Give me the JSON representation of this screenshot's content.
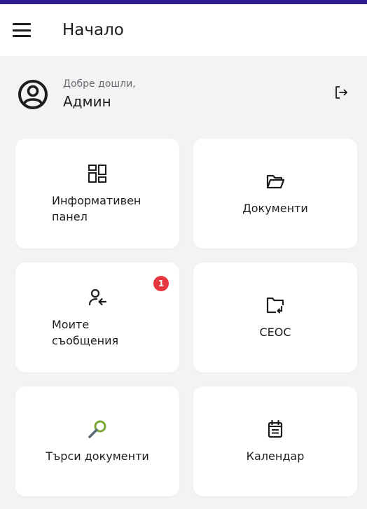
{
  "app_bar": {
    "title": "Начало",
    "menu_icon": "hamburger-menu-icon"
  },
  "welcome": {
    "greeting": "Добре дошли,",
    "user_name": "Админ",
    "avatar_icon": "user-circle-icon",
    "logout_icon": "logout-icon"
  },
  "tiles": [
    {
      "label": "Информативен\nпанел",
      "icon": "dashboard-icon"
    },
    {
      "label": "Документи",
      "icon": "folder-open-icon"
    },
    {
      "label": "Моите\nсъобщения",
      "icon": "user-message-icon",
      "badge": "1"
    },
    {
      "label": "СЕОС",
      "icon": "folder-incoming-icon"
    },
    {
      "label": "Търси документи",
      "icon": "search-icon"
    },
    {
      "label": "Календар",
      "icon": "calendar-icon"
    }
  ],
  "colors": {
    "top_strip": "#2e1d8f",
    "background": "#f3f3f5",
    "tile": "#ffffff",
    "badge": "#e5373f",
    "search_icon_ring": "#78a832",
    "search_icon_handle": "#5a6b7a"
  }
}
